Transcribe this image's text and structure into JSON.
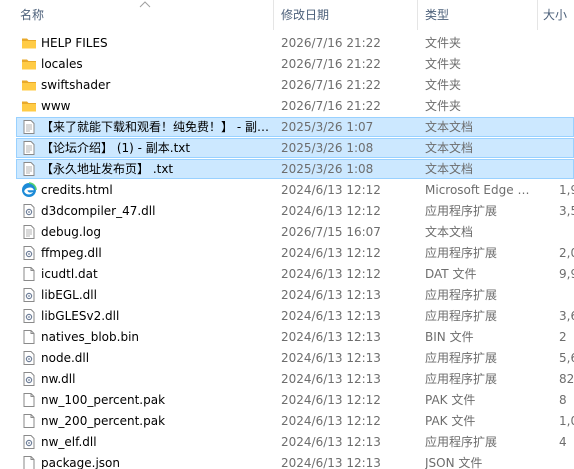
{
  "columns": {
    "name": "名称",
    "date": "修改日期",
    "type": "类型",
    "size": "大小"
  },
  "colors": {
    "selection_bg": "#cce8ff",
    "selection_border": "#99d1ff",
    "folder": "#ffcb45",
    "edge": "#1d8bd7"
  },
  "files": [
    {
      "name": "HELP FILES",
      "date": "2026/7/16 21:22",
      "type": "文件夹",
      "size": "",
      "icon": "folder-icon",
      "selected": false
    },
    {
      "name": "locales",
      "date": "2026/7/16 21:22",
      "type": "文件夹",
      "size": "",
      "icon": "folder-icon",
      "selected": false
    },
    {
      "name": "swiftshader",
      "date": "2026/7/16 21:22",
      "type": "文件夹",
      "size": "",
      "icon": "folder-icon",
      "selected": false
    },
    {
      "name": "www",
      "date": "2026/7/16 21:22",
      "type": "文件夹",
      "size": "",
      "icon": "folder-icon",
      "selected": false
    },
    {
      "name": "【来了就能下载和观看！纯免费！】 - 副…",
      "date": "2025/3/26 1:07",
      "type": "文本文档",
      "size": "",
      "icon": "text-file-icon",
      "selected": true
    },
    {
      "name": "【论坛介绍】 (1) - 副本.txt",
      "date": "2025/3/26 1:08",
      "type": "文本文档",
      "size": "",
      "icon": "text-file-icon",
      "selected": true
    },
    {
      "name": "【永久地址发布页】 .txt",
      "date": "2025/3/26 1:08",
      "type": "文本文档",
      "size": "",
      "icon": "text-file-icon",
      "selected": true
    },
    {
      "name": "credits.html",
      "date": "2024/6/13 12:12",
      "type": "Microsoft Edge …",
      "size": "1,9",
      "icon": "edge-icon",
      "selected": false
    },
    {
      "name": "d3dcompiler_47.dll",
      "date": "2024/6/13 12:12",
      "type": "应用程序扩展",
      "size": "3,5",
      "icon": "dll-file-icon",
      "selected": false
    },
    {
      "name": "debug.log",
      "date": "2026/7/15 16:07",
      "type": "文本文档",
      "size": "",
      "icon": "text-file-icon",
      "selected": false
    },
    {
      "name": "ffmpeg.dll",
      "date": "2024/6/13 12:12",
      "type": "应用程序扩展",
      "size": "2,0",
      "icon": "dll-file-icon",
      "selected": false
    },
    {
      "name": "icudtl.dat",
      "date": "2024/6/13 12:12",
      "type": "DAT 文件",
      "size": "9,9",
      "icon": "blank-file-icon",
      "selected": false
    },
    {
      "name": "libEGL.dll",
      "date": "2024/6/13 12:13",
      "type": "应用程序扩展",
      "size": "",
      "icon": "dll-file-icon",
      "selected": false
    },
    {
      "name": "libGLESv2.dll",
      "date": "2024/6/13 12:13",
      "type": "应用程序扩展",
      "size": "3,6",
      "icon": "dll-file-icon",
      "selected": false
    },
    {
      "name": "natives_blob.bin",
      "date": "2024/6/13 12:13",
      "type": "BIN 文件",
      "size": "2",
      "icon": "blank-file-icon",
      "selected": false
    },
    {
      "name": "node.dll",
      "date": "2024/6/13 12:13",
      "type": "应用程序扩展",
      "size": "5,6",
      "icon": "dll-file-icon",
      "selected": false
    },
    {
      "name": "nw.dll",
      "date": "2024/6/13 12:13",
      "type": "应用程序扩展",
      "size": "82,4",
      "icon": "dll-file-icon",
      "selected": false
    },
    {
      "name": "nw_100_percent.pak",
      "date": "2024/6/13 12:12",
      "type": "PAK 文件",
      "size": "8",
      "icon": "blank-file-icon",
      "selected": false
    },
    {
      "name": "nw_200_percent.pak",
      "date": "2024/6/13 12:12",
      "type": "PAK 文件",
      "size": "1,0",
      "icon": "blank-file-icon",
      "selected": false
    },
    {
      "name": "nw_elf.dll",
      "date": "2024/6/13 12:13",
      "type": "应用程序扩展",
      "size": "4",
      "icon": "dll-file-icon",
      "selected": false
    },
    {
      "name": "package.json",
      "date": "2024/6/13 12:13",
      "type": "JSON 文件",
      "size": "",
      "icon": "blank-file-icon",
      "selected": false
    }
  ]
}
